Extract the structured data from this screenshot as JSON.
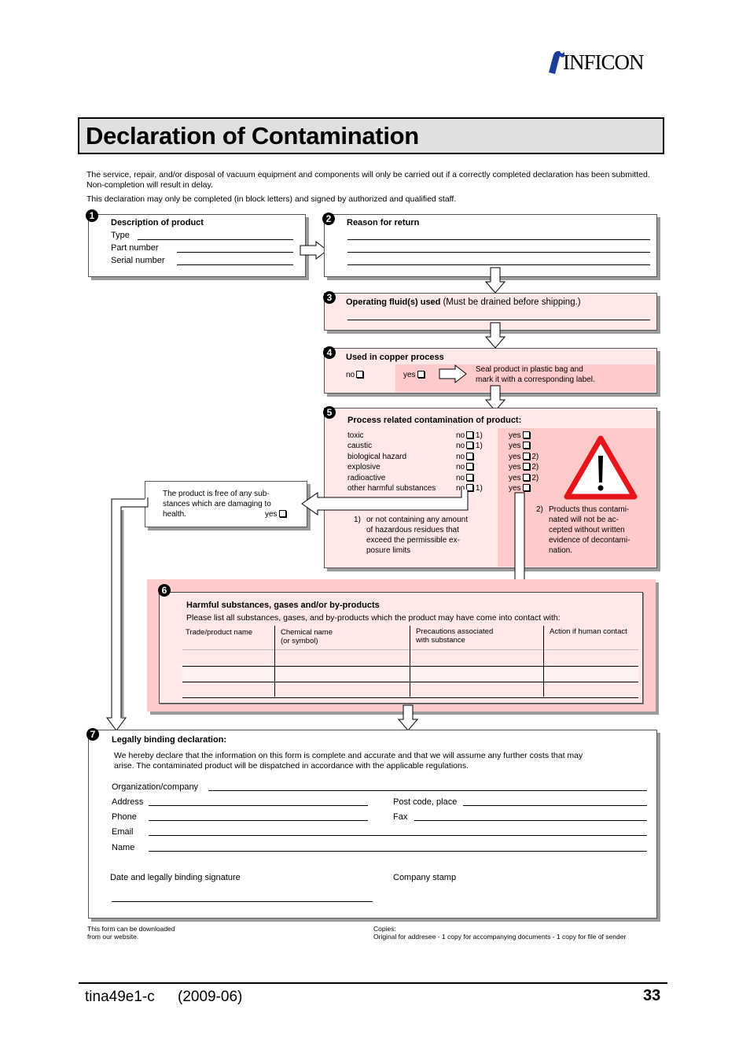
{
  "brand": {
    "name": "INFICON",
    "logo_color": "#1a3c9c"
  },
  "title": "Declaration of Contamination",
  "intro": [
    "The service, repair, and/or disposal of vacuum equipment and components will only be carried out if a correctly completed declaration has been submitted. Non-completion will result in delay.",
    "This declaration may only be completed (in block letters) and signed by authorized and qualified staff."
  ],
  "sections": {
    "s1": {
      "number": "1",
      "title": "Description of product",
      "fields": [
        "Type",
        "Part number",
        "Serial number"
      ]
    },
    "s2": {
      "number": "2",
      "title": "Reason for return"
    },
    "s3": {
      "number": "3",
      "title": "Operating fluid(s) used",
      "note": "(Must be drained before shipping.)"
    },
    "s4": {
      "number": "4",
      "title": "Used in copper process",
      "no": "no",
      "yes": "yes",
      "instruction_line1": "Seal product in plastic bag and",
      "instruction_line2": "mark it with a corresponding label."
    },
    "s5": {
      "number": "5",
      "title": "Process related contamination of product:",
      "rows": [
        {
          "label": "toxic",
          "no": "no",
          "no_note": "1)",
          "yes": "yes",
          "yes_note": ""
        },
        {
          "label": "caustic",
          "no": "no",
          "no_note": "1)",
          "yes": "yes",
          "yes_note": ""
        },
        {
          "label": "biological hazard",
          "no": "no",
          "no_note": "",
          "yes": "yes",
          "yes_note": "2)"
        },
        {
          "label": "explosive",
          "no": "no",
          "no_note": "",
          "yes": "yes",
          "yes_note": "2)"
        },
        {
          "label": "radioactive",
          "no": "no",
          "no_note": "",
          "yes": "yes",
          "yes_note": "2)"
        },
        {
          "label": "other harmful substances",
          "no": "no",
          "no_note": "1)",
          "yes": "yes",
          "yes_note": ""
        }
      ],
      "footnote1_num": "1)",
      "footnote1": [
        "or not containing any amount",
        "of hazardous residues that",
        "exceed the permissible ex-",
        "posure limits"
      ],
      "footnote2_num": "2)",
      "footnote2": [
        "Products thus contami-",
        "nated will not be ac-",
        "cepted without written",
        "evidence of decontami-",
        "nation."
      ],
      "free_box": [
        "The product is free of any sub-",
        "stances which are damaging to",
        "health."
      ],
      "free_box_yes": "yes"
    },
    "s6": {
      "number": "6",
      "title": "Harmful substances, gases and/or by-products",
      "subtitle": "Please list all substances, gases, and by-products which the product may have come into contact with:",
      "columns": [
        {
          "line1": "Trade/product name",
          "line2": ""
        },
        {
          "line1": "Chemical name",
          "line2": "(or symbol)"
        },
        {
          "line1": "Precautions associated",
          "line2": "with substance"
        },
        {
          "line1": "Action if human contact",
          "line2": ""
        }
      ],
      "rows": 3
    },
    "s7": {
      "number": "7",
      "title": "Legally binding declaration:",
      "text": [
        "We hereby declare that the information on this form is complete and accurate and that we will assume any further costs that may",
        "arise. The contaminated product will be dispatched in accordance with the applicable regulations."
      ],
      "fields": {
        "organization": "Organization/company",
        "address": "Address",
        "postcode": "Post code, place",
        "phone": "Phone",
        "fax": "Fax",
        "email": "Email",
        "name": "Name"
      },
      "signature": "Date and legally binding signature",
      "stamp": "Company stamp"
    }
  },
  "form_footer": {
    "download": [
      "This form can be downloaded",
      "from our website."
    ],
    "copies_label": "Copies:",
    "copies": "Original for addresee - 1 copy for accompanying documents - 1 copy for file of sender"
  },
  "page_footer": {
    "doc_id": "tina49e1-c",
    "date": "(2009-06)",
    "page": "33"
  },
  "colors": {
    "pink_light": "#ffe8e8",
    "pink_dark": "#ffcaca",
    "warning_red": "#e8141c"
  }
}
